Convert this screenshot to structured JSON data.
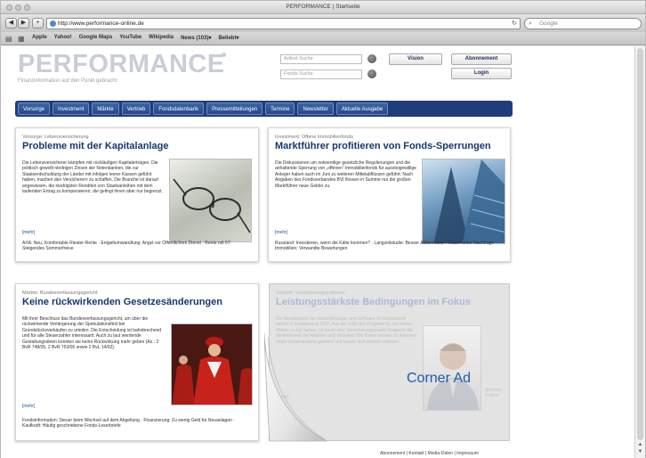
{
  "browser": {
    "window_title": "PERFORMANCE | Startseite",
    "nav_back_icon": "back-arrow-icon",
    "nav_forward_icon": "forward-arrow-icon",
    "add_icon": "plus-icon",
    "url": "http://www.performance-online.de",
    "url_favicon": "globe-icon",
    "reload_icon": "reload-icon",
    "search_placeholder": "Google",
    "bookmarks_icons": [
      "book-icon",
      "grid-icon"
    ],
    "bookmarks": [
      "Apple",
      "Yahoo!",
      "Google Maps",
      "YouTube",
      "Wikipedia",
      "News (103)▾",
      "Beliebt▾"
    ]
  },
  "site": {
    "logo": "PERFORMANCE",
    "tagline": "Finanzinformation auf den Punkt gebracht",
    "header": {
      "field1_placeholder": "Artikel-Suche",
      "field2_placeholder": "Fonds-Suche",
      "button_vision": "Vision",
      "button_subscription": "Abonnement",
      "button_login": "Login"
    },
    "menu": [
      "Vorsorge",
      "Investment",
      "Märkte",
      "Vertrieb",
      "Fondsdatenbank",
      "Pressemitteilungen",
      "Termine",
      "Newsletter",
      "Aktuelle Ausgabe"
    ],
    "footer": "Abonnement | Kontakt | Media-Daten | Impressum"
  },
  "cards": [
    {
      "kicker": "Vorsorge: Lebensversicherung",
      "title": "Probleme mit der Kapitalanlage",
      "text": "Die Lebensversicherer kämpfen mit rückläufigen Kapitalerträgen. Die politisch gewollt niedrigen Zinsen der Notenbanken, die zur Staatsentschuldung der Länder mit infolgen leerer Kassen geführt haben, machen den Versicherern zu schaffen. Die Branche ist darauf angewiesen, die niedrigsten Renditen von Staatsanleihen mit dem laufenden Ertrag zu kompensieren, die gelingt ihnen aber nur begrenzt.",
      "more": "[mehr]",
      "links": "AXA: Neu, Komfortable Riester-Rente · Entgeltumwandlung: Angst vor Öffentlichem Dienst · Rente mit 67: Steigendes Sommerfreise"
    },
    {
      "kicker": "Investment: Offene Immobilienfonds",
      "title": "Marktführer profitieren von Fonds-Sperrungen",
      "text": "Die Diskussionen um notwendige gesetzliche Regulierungen und die anhaltende Sperrung von „offenen“ Immobilienfonds für aussteigewillige Anleger haben auch im Juni zu weiteren Mittelabflüssen geführt. Nach Angaben des Fondsverbandes BVI flossen in Summe nur die großen Marktführer neue Gelder zu.",
      "more": "[mehr]",
      "links": "Russland: Investieren, wenn die Kälte kommen? · Langzeitstudie: Besser Aktienmarkt + Dauer unter Nachfrage · Immobilien: Verwandte Bewertungen"
    },
    {
      "kicker": "Märkte: Bundesverfassungsgericht",
      "title": "Keine rückwirkenden Gesetzesänderungen",
      "text": "Mit ihrer Beschluss das Bundesverfassungsgericht, um über die rückwirkende Verlängerung der Spekulationsfrist bei Grundstücksverkäufen zu urteilen. Die Entscheidung ist bahnbrechend und für alle Steuerzahler interessant. Auch zu laut werdende Gestaltungsideen konnten sie keine Rückwirkung mehr geben (Az.: 2 BvR 748/05, 2 BvR 753/05 sowie 2 BvL 14/02).",
      "more": "[mehr]",
      "links": "Fondsinformation: Steuer beim Wechsel auf dem Abgeltung · Finanzierung: Zu wenig Geld für Neuanlagen · Kaufkraft: Häufig geschriebene Fonds-Leserbriefe"
    },
    {
      "kicker": "Vertrieb: Versicherungssoftware",
      "title": "Leistungsstärkste Bedingungen im Fokus",
      "text": "Die Marktkenner bei Versicherungen und Software ist kommerziell bedarf in Erweiterung 2010. Aus der Fülle der Programme, mit denen Makler zu tun haben, ist heute eine Versicherungsmarkt-Vergleich die Vertriebswelt der Anbieter und Vertriebe. Die Daten werden im Rahmen eines Gesamtpakets geliefert und lassen sich schnell erfassen.",
      "more": "[mehr]",
      "photo_caption": "Andreas Franke"
    }
  ],
  "overlay": {
    "corner_ad_label": "Corner Ad"
  }
}
